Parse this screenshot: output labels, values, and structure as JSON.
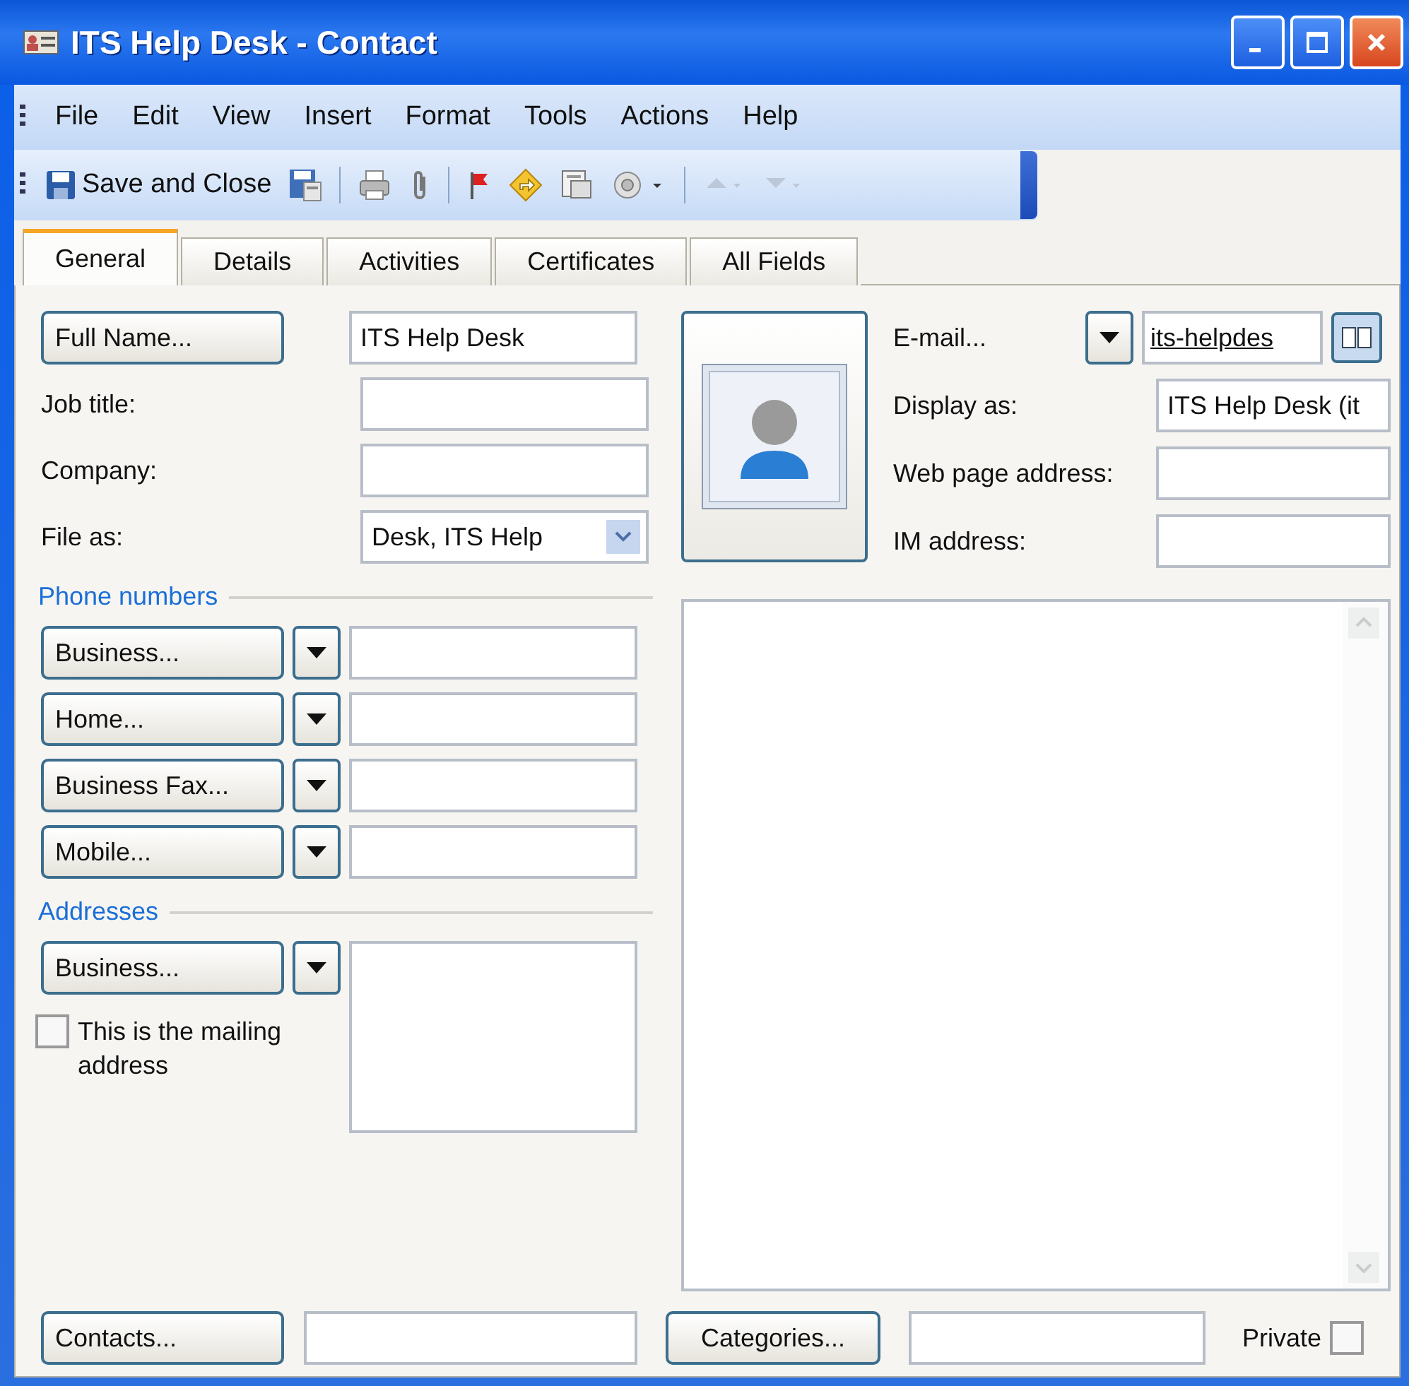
{
  "window": {
    "title": "ITS Help Desk - Contact"
  },
  "menu": [
    {
      "label": "File"
    },
    {
      "label": "Edit"
    },
    {
      "label": "View"
    },
    {
      "label": "Insert"
    },
    {
      "label": "Format"
    },
    {
      "label": "Tools"
    },
    {
      "label": "Actions"
    },
    {
      "label": "Help"
    }
  ],
  "toolbar": {
    "save_and_close": "Save and Close"
  },
  "tabs": [
    {
      "label": "General",
      "selected": true
    },
    {
      "label": "Details",
      "selected": false
    },
    {
      "label": "Activities",
      "selected": false
    },
    {
      "label": "Certificates",
      "selected": false
    },
    {
      "label": "All Fields",
      "selected": false
    }
  ],
  "full_name": {
    "button": "Full Name...",
    "value": "ITS Help Desk"
  },
  "job_title": {
    "label": "Job title:"
  },
  "company": {
    "label": "Company:"
  },
  "file_as": {
    "label": "File as:",
    "value": "Desk, ITS Help"
  },
  "phone_numbers": {
    "heading": "Phone numbers",
    "entries": [
      {
        "button": "Business..."
      },
      {
        "button": "Home..."
      },
      {
        "button": "Business Fax..."
      },
      {
        "button": "Mobile..."
      }
    ]
  },
  "addresses": {
    "heading": "Addresses",
    "button": "Business...",
    "mailing": {
      "label": "This is the mailing address",
      "checked": false
    }
  },
  "email": {
    "button": "E-mail...",
    "value": "its-helpdes"
  },
  "display_as": {
    "label": "Display as:",
    "value": "ITS Help Desk (it"
  },
  "web_page": {
    "label": "Web page address:"
  },
  "im_address": {
    "label": "IM address:"
  },
  "contacts": {
    "button": "Contacts..."
  },
  "categories": {
    "button": "Categories..."
  },
  "private": {
    "label": "Private",
    "checked": false
  }
}
